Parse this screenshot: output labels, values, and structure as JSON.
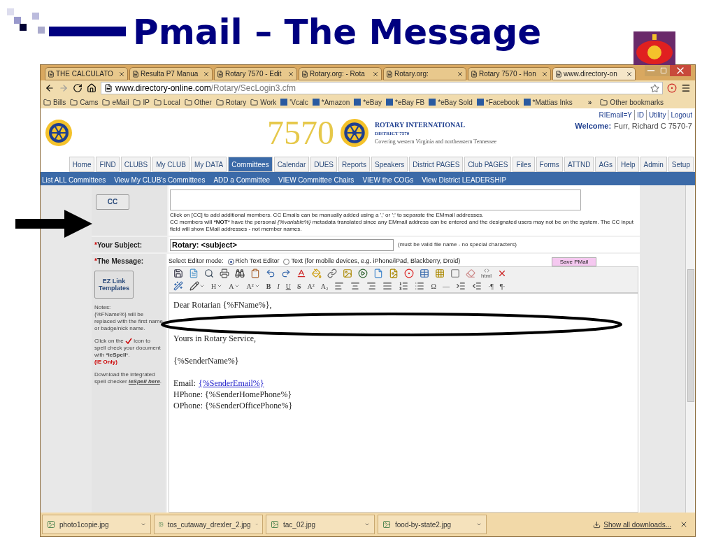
{
  "slide": {
    "title": "Pmail – The Message"
  },
  "browser": {
    "tabs": [
      {
        "label": "THE CALCULATO",
        "selected": false
      },
      {
        "label": "Resulta P7 Manua",
        "selected": false
      },
      {
        "label": "Rotary 7570 - Edit",
        "selected": false
      },
      {
        "label": "Rotary.org: - Rota",
        "selected": false
      },
      {
        "label": "Rotary.org:",
        "selected": false
      },
      {
        "label": "Rotary 7570 - Hon",
        "selected": false
      },
      {
        "label": "www.directory-on",
        "selected": true
      }
    ],
    "address": {
      "domain": "www.directory-online.com",
      "path": "/Rotary/SecLogin3.cfm"
    },
    "bookmarks": [
      {
        "label": "Bills",
        "kind": "folder"
      },
      {
        "label": "Cams",
        "kind": "folder"
      },
      {
        "label": "eMail",
        "kind": "folder"
      },
      {
        "label": "IP",
        "kind": "folder"
      },
      {
        "label": "Local",
        "kind": "folder"
      },
      {
        "label": "Other",
        "kind": "folder"
      },
      {
        "label": "Rotary",
        "kind": "folder"
      },
      {
        "label": "Work",
        "kind": "folder"
      },
      {
        "label": "'Vcalc",
        "kind": "app"
      },
      {
        "label": "*Amazon",
        "kind": "app"
      },
      {
        "label": "*eBay",
        "kind": "app"
      },
      {
        "label": "*eBay FB",
        "kind": "app"
      },
      {
        "label": "*eBay Sold",
        "kind": "app"
      },
      {
        "label": "*Facebook",
        "kind": "app"
      },
      {
        "label": "*Mattias Inks",
        "kind": "app"
      }
    ],
    "more_bookmarks": "»",
    "other_bookmarks": "Other bookmarks"
  },
  "page": {
    "header": {
      "top_links": [
        "RIEmail=Y",
        "ID",
        "Utility",
        "Logout"
      ],
      "welcome_label": "Welcome:",
      "welcome_name": "Furr, Richard C 7570-7",
      "district_number": "7570",
      "org_name": "ROTARY INTERNATIONAL",
      "district": "DISTRICT 7570",
      "tagline": "Covering western Virginia and northeastern Tennessee"
    },
    "nav": [
      {
        "label": "Home",
        "selected": false
      },
      {
        "label": "FIND",
        "selected": false
      },
      {
        "label": "CLUBS",
        "selected": false
      },
      {
        "label": "My CLUB",
        "selected": false
      },
      {
        "label": "My DATA",
        "selected": false
      },
      {
        "label": "Committees",
        "selected": true
      },
      {
        "label": "Calendar",
        "selected": false
      },
      {
        "label": "DUES",
        "selected": false
      },
      {
        "label": "Reports",
        "selected": false
      },
      {
        "label": "Speakers",
        "selected": false
      },
      {
        "label": "District PAGES",
        "selected": false
      },
      {
        "label": "Club PAGES",
        "selected": false
      },
      {
        "label": "Files",
        "selected": false
      },
      {
        "label": "Forms",
        "selected": false
      },
      {
        "label": "ATTND",
        "selected": false
      },
      {
        "label": "AGs",
        "selected": false
      },
      {
        "label": "Help",
        "selected": false
      },
      {
        "label": "Admin",
        "selected": false
      },
      {
        "label": "Setup",
        "selected": false
      }
    ],
    "subnav": [
      "List ALL Committees",
      "View My CLUB's Committees",
      "ADD a Committee",
      "VIEW Committee Chairs",
      "VIEW the COGs",
      "View District LEADERSHIP"
    ],
    "form": {
      "cc_button": "CC",
      "cc_help": [
        "Click on [CC] to add additional members. CC Emails can be manually added using a ',' or ';' to separate the EMmail addresses.",
        "CC members will ***NOT*** have the personal *{%variable%}* metadata translated since any EMmail address can be entered and the designated users may not be on the system. The CC input field will show EMail addresses - not member names."
      ],
      "subject_label": "Your Subject:",
      "subject_value": "Rotary: <subject>",
      "subject_hint": "(must be valid file name - no special characters)",
      "message_label": "The Message:",
      "required_mark": "*",
      "editor_mode_label": "Select Editor mode:",
      "editor_modes": [
        {
          "label": "Rich Text Editor",
          "selected": true
        },
        {
          "label": "Text (for mobile devices, e.g. iPhone/iPad, Blackberry, Droid)",
          "selected": false
        }
      ],
      "save_button": "Save PMail",
      "ez_button": "EZ Link Templates",
      "notes": "Notes:\n{%FName%} will be replaced with the first name or badge/nick name.",
      "spell_before": "Click on the",
      "spell_after": "icon to spell check your document with ***ieSpell***.",
      "ie_only": "(IE Only)",
      "download_text": "Download the integrated spell checker",
      "download_link": "ieSpell here",
      "download_end": ".",
      "toolbar": {
        "html_label": "html",
        "dropdowns": [
          "H",
          "A",
          "A²"
        ],
        "styles": [
          {
            "label": "B",
            "kind": "bold"
          },
          {
            "label": "I",
            "kind": "italic"
          },
          {
            "label": "U",
            "kind": "underline"
          },
          {
            "label": "S",
            "kind": "strike"
          },
          {
            "label": "A²",
            "kind": "plain"
          },
          {
            "label": "A₂",
            "kind": "plain"
          }
        ],
        "symbols": [
          "Ω",
          "—"
        ],
        "marks": [
          "·¶",
          "¶·"
        ]
      },
      "editor_lines": [
        {
          "kind": "text",
          "text": "Dear Rotarian {%FName%},"
        },
        {
          "kind": "blank"
        },
        {
          "kind": "blank"
        },
        {
          "kind": "text",
          "text": "Yours in Rotary Service,"
        },
        {
          "kind": "blank"
        },
        {
          "kind": "text",
          "text": "{%SenderName%}"
        },
        {
          "kind": "blank"
        },
        {
          "kind": "email",
          "text": "Email:",
          "link": "{%SenderEmail%}"
        },
        {
          "kind": "text",
          "text": "HPhone: {%SenderHomePhone%}"
        },
        {
          "kind": "text",
          "text": "OPhone: {%SenderOfficePhone%}"
        }
      ]
    }
  },
  "downloads": {
    "files": [
      "photo1copie.jpg",
      "tos_cutaway_drexler_2.jpg",
      "tac_02.jpg",
      "food-by-state2.jpg"
    ],
    "show_all": "Show all downloads..."
  }
}
